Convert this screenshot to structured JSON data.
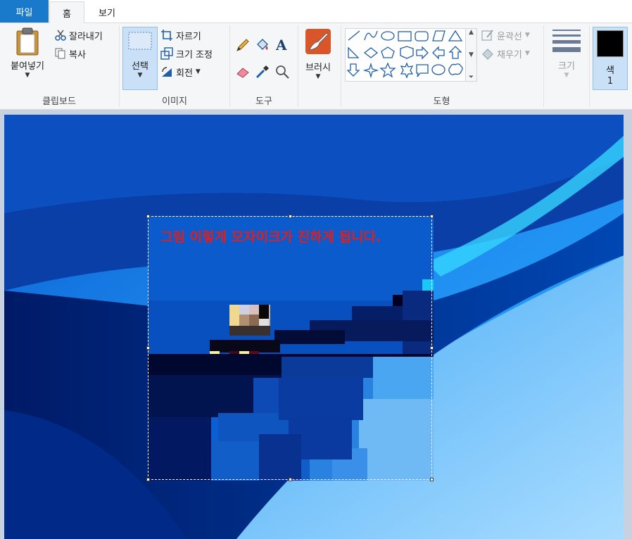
{
  "tabs": {
    "file": "파일",
    "home": "홈",
    "view": "보기"
  },
  "clipboard": {
    "paste": "붙여넣기",
    "cut": "잘라내기",
    "copy": "복사",
    "label": "클립보드"
  },
  "image": {
    "select": "선택",
    "crop": "자르기",
    "resize": "크기 조정",
    "rotate": "회전",
    "label": "이미지"
  },
  "tools": {
    "label": "도구"
  },
  "brushes": {
    "label": "브러시"
  },
  "shapes": {
    "outline": "윤곽선",
    "fill": "채우기",
    "label": "도형"
  },
  "size": {
    "label": "크기"
  },
  "color": {
    "label": "색",
    "number": "1",
    "value": "#000000"
  },
  "canvas": {
    "caption": "그림 이렇게 모자이크가 진하게 됩니다."
  },
  "colors": {
    "accent": "#1979ca",
    "caption": "#e01e1e"
  }
}
